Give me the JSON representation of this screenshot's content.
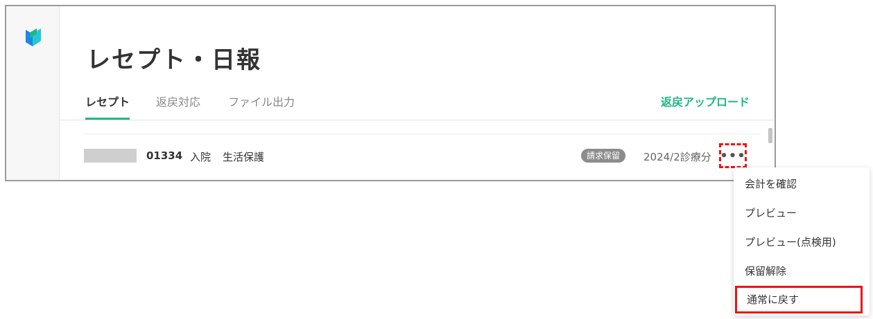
{
  "page": {
    "title": "レセプト・日報"
  },
  "tabs": [
    {
      "label": "レセプト",
      "active": true
    },
    {
      "label": "返戻対応",
      "active": false
    },
    {
      "label": "ファイル出力",
      "active": false
    }
  ],
  "header_action": {
    "label": "返戻アップロード"
  },
  "row": {
    "patient_id": "01334",
    "admission": "入院",
    "insurance": "生活保護",
    "status_badge": "請求保留",
    "period": "2024/2診療分",
    "more_label": "•••"
  },
  "menu": {
    "items": [
      {
        "label": "会計を確認"
      },
      {
        "label": "プレビュー"
      },
      {
        "label": "プレビュー(点検用)"
      },
      {
        "label": "保留解除"
      },
      {
        "label": "通常に戻す"
      }
    ]
  },
  "colors": {
    "accent": "#1fb883",
    "highlight": "#ee1111",
    "badge": "#8c8c8c"
  },
  "icons": {
    "logo": "app-logo-icon",
    "more": "more-icon"
  }
}
